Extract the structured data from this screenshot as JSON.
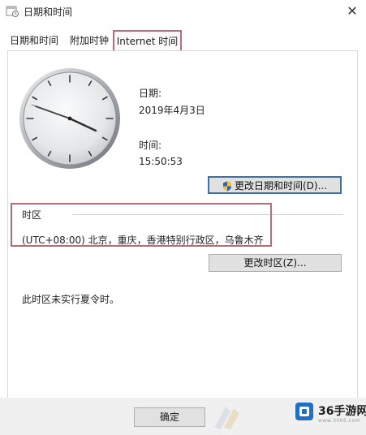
{
  "window": {
    "title": "日期和时间"
  },
  "tabs": [
    {
      "label": "日期和时间"
    },
    {
      "label": "附加时钟"
    },
    {
      "label": "Internet 时间"
    }
  ],
  "date": {
    "label": "日期:",
    "value": "2019年4月3日"
  },
  "time": {
    "label": "时间:",
    "value": "15:50:53"
  },
  "buttons": {
    "change_datetime": "更改日期和时间(D)...",
    "change_timezone": "更改时区(Z)...",
    "ok": "确定"
  },
  "timezone": {
    "heading": "时区",
    "value": "(UTC+08:00) 北京，重庆，香港特别行政区，乌鲁木齐"
  },
  "dst_note": "此时区未实行夏令时。",
  "watermark": {
    "brand": "36手游网",
    "site": "www.3066.com"
  },
  "colors": {
    "highlight": "#b86c78",
    "focus": "#3d6fa8",
    "logo": "#1f6fc5"
  },
  "icons": {
    "app": "calendar-clock-icon",
    "close": "close-icon",
    "shield": "uac-shield-icon"
  }
}
